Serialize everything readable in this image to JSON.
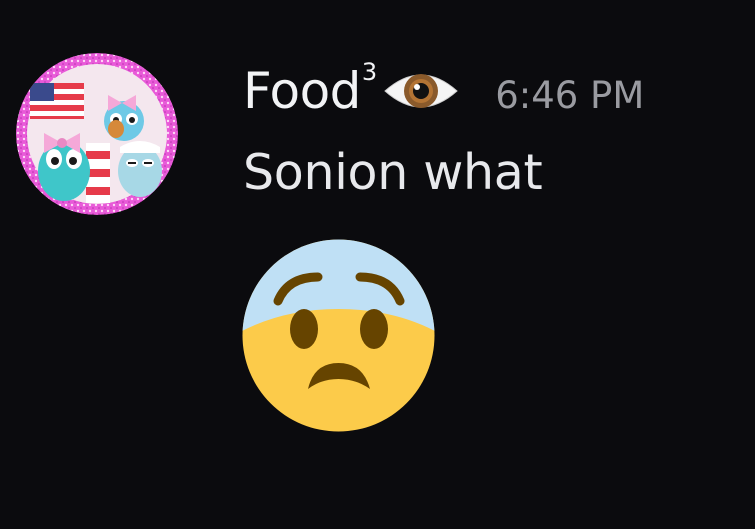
{
  "message": {
    "author": "Food",
    "author_superscript": "3",
    "author_emoji": "eye-icon",
    "timestamp": "6:46 PM",
    "content": "Sonion what",
    "attached_emoji": "anxious-face-icon"
  },
  "colors": {
    "background": "#0b0b0e",
    "username": "#f2f3f5",
    "timestamp": "#9a9ba1",
    "content": "#e8e9ec",
    "emoji_yellow": "#fccb4a",
    "emoji_blue": "#bfe0f5"
  }
}
